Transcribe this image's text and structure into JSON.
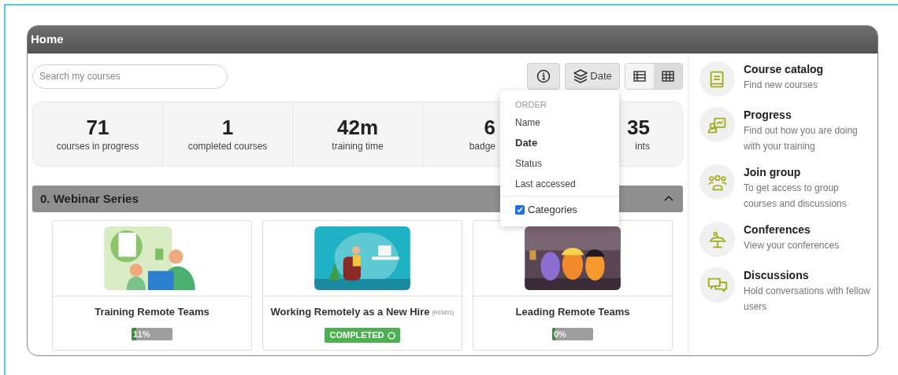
{
  "window": {
    "title": "Home"
  },
  "search": {
    "placeholder": "Search my courses"
  },
  "toolbar": {
    "sort_button": "Date",
    "views": [
      {
        "selected": false
      },
      {
        "selected": true
      }
    ]
  },
  "stats": [
    {
      "value": "71",
      "label": "courses in progress"
    },
    {
      "value": "1",
      "label": "completed courses"
    },
    {
      "value": "42m",
      "label": "training time"
    },
    {
      "value": "6",
      "label": "badge"
    },
    {
      "value": "35",
      "label": "ints"
    }
  ],
  "sort_menu": {
    "heading": "ORDER",
    "options": [
      {
        "label": "Name",
        "selected": false
      },
      {
        "label": "Date",
        "selected": true
      },
      {
        "label": "Status",
        "selected": false
      },
      {
        "label": "Last accessed",
        "selected": false
      }
    ],
    "categories": {
      "label": "Categories",
      "checked": true
    }
  },
  "section": {
    "title": "0. Webinar Series",
    "expanded": true
  },
  "courses": [
    {
      "title": "Training Remote Teams",
      "kind": "progress",
      "level": 0.11,
      "reading": "11%"
    },
    {
      "title": "Working Remotely as a New Hire",
      "code": "(REM01)",
      "kind": "completed",
      "status": "COMPLETED"
    },
    {
      "title": "Leading Remote Teams",
      "kind": "progress",
      "level": 0,
      "reading": "0%"
    }
  ],
  "sidebar": [
    {
      "title": "Course catalog",
      "text": "Find new courses"
    },
    {
      "title": "Progress",
      "text": "Find out how you are doing with your training"
    },
    {
      "title": "Join group",
      "text": "To get access to group courses and discussions"
    },
    {
      "title": "Conferences",
      "text": "View your conferences"
    },
    {
      "title": "Discussions",
      "text": "Hold conversations with fellow users"
    }
  ]
}
